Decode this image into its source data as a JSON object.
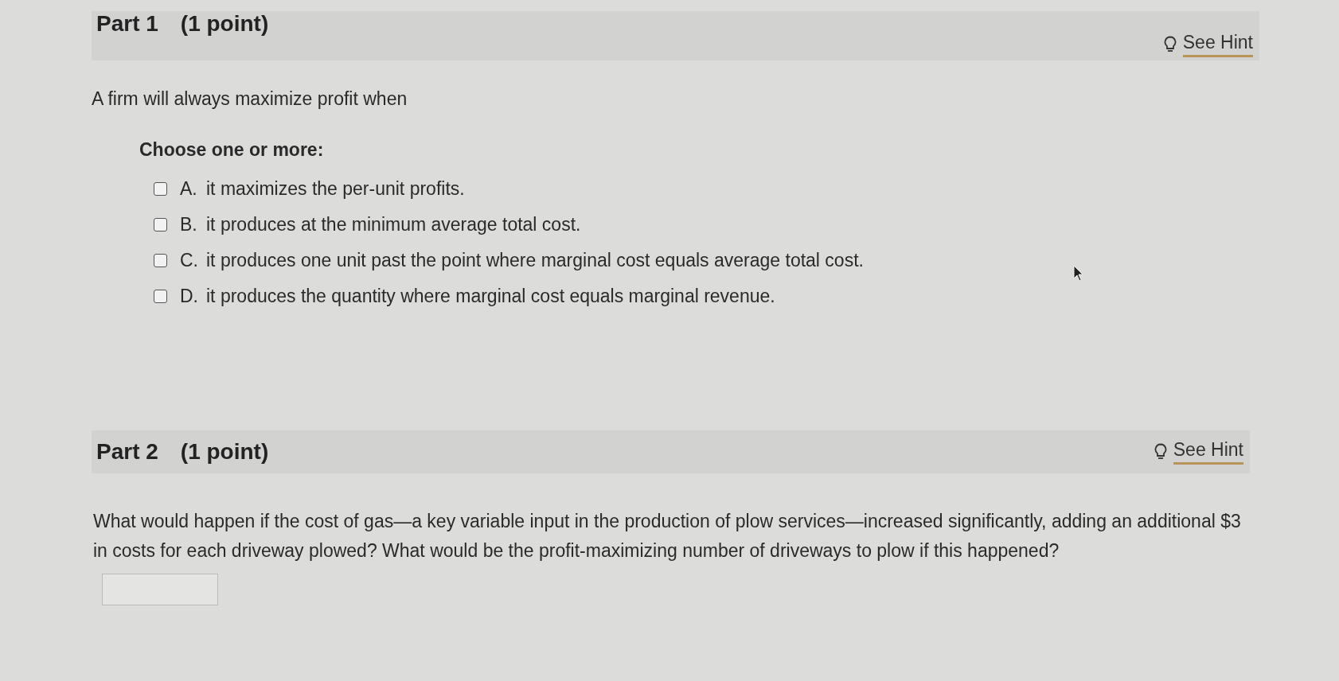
{
  "parts": [
    {
      "title": "Part 1",
      "points": "(1 point)",
      "hint": "See Hint",
      "question": "A firm will always maximize profit when",
      "instruction": "Choose one or more:",
      "options": [
        {
          "label": "A.",
          "text": "it maximizes the per-unit profits.",
          "checked": false
        },
        {
          "label": "B.",
          "text": "it produces at the minimum average total cost.",
          "checked": false
        },
        {
          "label": "C.",
          "text": "it produces one unit past the point where marginal cost equals average total cost.",
          "checked": false
        },
        {
          "label": "D.",
          "text": "it produces the quantity where marginal cost equals marginal revenue.",
          "checked": false
        }
      ]
    },
    {
      "title": "Part 2",
      "points": "(1 point)",
      "hint": "See Hint",
      "question": "What would happen if the cost of gas—a key variable input in the production of plow services—increased significantly, adding an additional $3 in costs for each driveway plowed? What would be the profit-maximizing number of driveways to plow if this happened?",
      "answer_field": true
    }
  ]
}
